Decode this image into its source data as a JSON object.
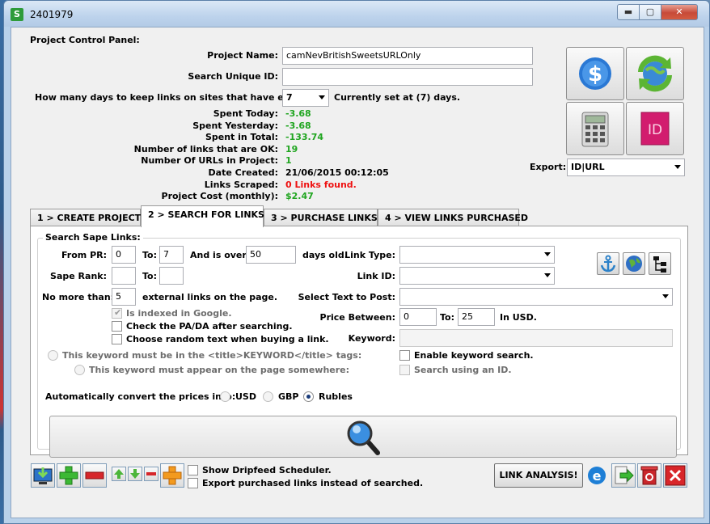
{
  "window": {
    "title": "2401979",
    "app_icon": "S",
    "min_glyph": "▬",
    "max_glyph": "▢",
    "close_glyph": "✕"
  },
  "panel": {
    "heading": "Project Control Panel:",
    "project_name_label": "Project Name:",
    "project_name_value": "camNevBritishSweetsURLOnly",
    "unique_id_label": "Search Unique ID:",
    "unique_id_value": "",
    "days_label": "How many days to keep links on sites that have errors:",
    "days_value": "7",
    "days_current": "Currently set at (7) days.",
    "stats": [
      {
        "label": "Spent Today:",
        "value": "-3.68",
        "color": "green"
      },
      {
        "label": "Spent Yesterday:",
        "value": "-3.68",
        "color": "green"
      },
      {
        "label": "Spent in Total:",
        "value": "-133.74",
        "color": "green"
      },
      {
        "label": "Number of links that are OK:",
        "value": "19",
        "color": "green"
      },
      {
        "label": "Number Of URLs in Project:",
        "value": "1",
        "color": "green"
      },
      {
        "label": "Date Created:",
        "value": "21/06/2015 00:12:05",
        "color": "black"
      },
      {
        "label": "Links Scraped:",
        "value": "0 Links found.",
        "color": "red"
      },
      {
        "label": "Project Cost (monthly):",
        "value": "$2.47",
        "color": "green"
      }
    ],
    "export_label": "Export:",
    "export_value": "ID|URL"
  },
  "big_buttons": [
    "dollar-icon",
    "refresh-globe-icon",
    "calculator-icon",
    "indesign-icon"
  ],
  "tabs": [
    {
      "label": "1 > CREATE PROJECT",
      "active": false
    },
    {
      "label": "2 > SEARCH FOR LINKS",
      "active": true
    },
    {
      "label": "3 > PURCHASE LINKS",
      "active": false
    },
    {
      "label": "4 > VIEW LINKS PURCHASED",
      "active": false
    }
  ],
  "search": {
    "group_title": "Search Sape Links:",
    "from_pr_label": "From PR:",
    "from_pr_value": "0",
    "to_label": "To:",
    "to_pr_value": "7",
    "over_label": "And is over:",
    "over_value": "50",
    "days_old_label": "days old.",
    "sape_rank_label": "Sape Rank:",
    "sape_rank_from": "",
    "sape_rank_to": "",
    "no_more_label": "No more than:",
    "no_more_value": "5",
    "external_label": "external links on the page.",
    "link_type_label": "Link Type:",
    "link_type_value": "",
    "link_id_label": "Link ID:",
    "link_id_value": "",
    "select_text_label": "Select Text to Post:",
    "select_text_value": "",
    "indexed_label": "Is indexed in Google.",
    "check_pa_label": "Check the PA/DA after searching.",
    "random_text_label": "Choose random text when buying a link.",
    "price_between_label": "Price Between:",
    "price_from": "0",
    "price_to_label": "To:",
    "price_to": "25",
    "usd_label": "In USD.",
    "keyword_label": "Keyword:",
    "keyword_value": "",
    "title_tag_label": "This keyword must be in the <title>KEYWORD</title> tags:",
    "page_somewhere_label": "This keyword must appear on the page somewhere:",
    "enable_keyword_label": "Enable keyword search.",
    "search_id_label": "Search using an ID.",
    "convert_label": "Automatically convert the prices into:",
    "currency_usd": "USD",
    "currency_gbp": "GBP",
    "currency_rubles": "Rubles",
    "selected_currency": "Rubles"
  },
  "toolbar": {
    "dripfeed_label": "Show Dripfeed Scheduler.",
    "export_purchased_label": "Export purchased links instead of searched.",
    "link_analysis_label": "LINK ANALYSIS!"
  },
  "colors": {
    "green": "#1fa51f",
    "red": "#e11111",
    "accent": "#1b3c7a"
  }
}
